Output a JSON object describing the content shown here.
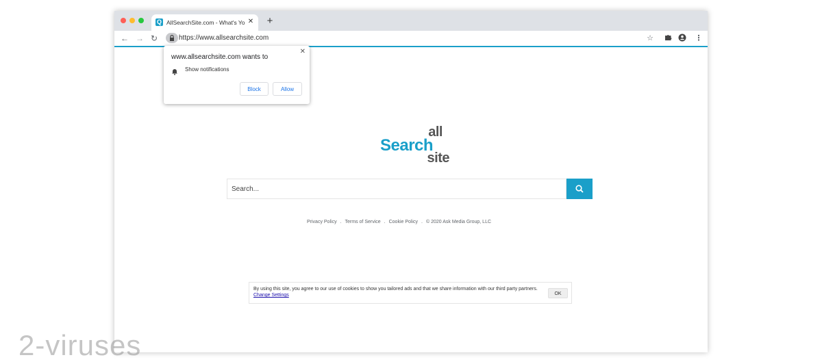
{
  "browser": {
    "tab_title": "AllSearchSite.com - What's Yo",
    "tab_favicon_letter": "Q",
    "tab_close": "✕",
    "new_tab": "+",
    "url": "https://www.allsearchsite.com",
    "accent_color": "#1a9fc9"
  },
  "permission_popup": {
    "title": "www.allsearchsite.com wants to",
    "permission": "Show notifications",
    "block_label": "Block",
    "allow_label": "Allow",
    "close": "✕"
  },
  "logo": {
    "line1": "all",
    "line2": "Search",
    "line3": "site"
  },
  "search": {
    "placeholder": "Search..."
  },
  "footer": {
    "links": [
      "Privacy Policy",
      "Terms of Service",
      "Cookie Policy"
    ],
    "separator": ".",
    "copyright": "© 2020 Ask Media Group, LLC"
  },
  "cookie_banner": {
    "text": "By using this site, you agree to our use of cookies to show you tailored ads and that we share information with our third party partners.",
    "link": "Change Settings",
    "ok_label": "OK"
  },
  "watermark": "2-viruses"
}
